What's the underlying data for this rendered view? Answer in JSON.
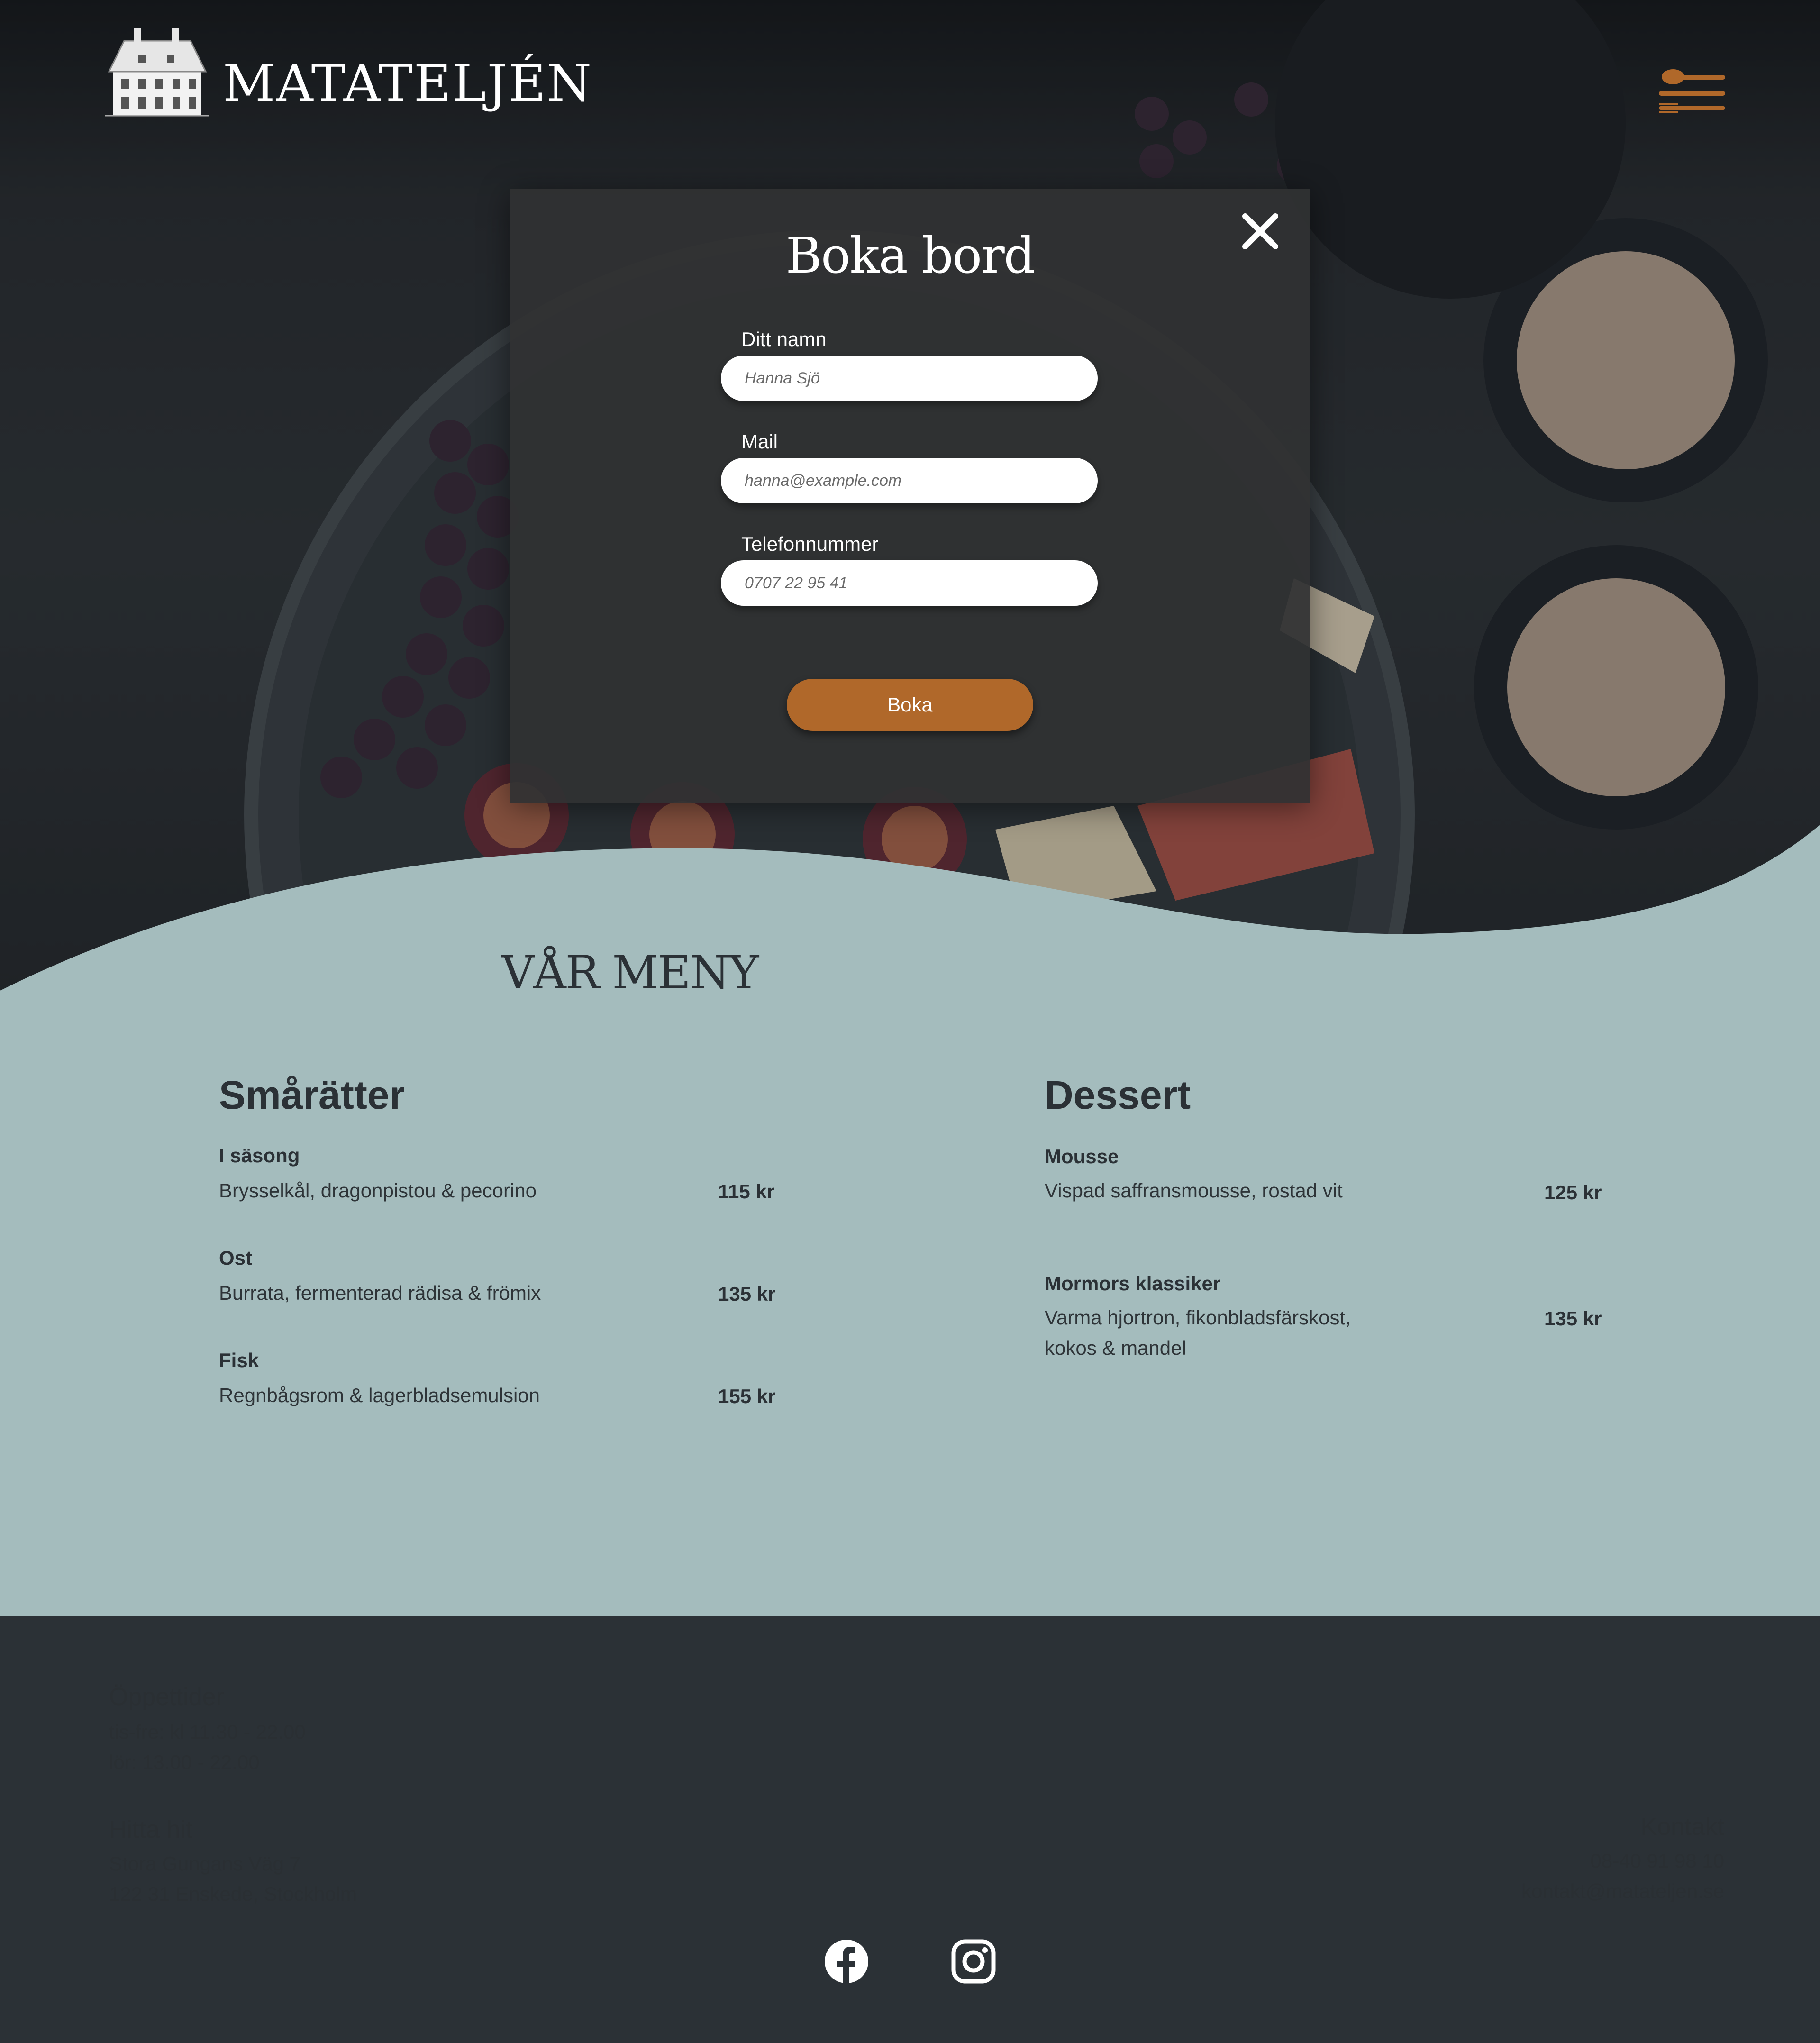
{
  "header": {
    "logo_text": "MATATELJÉN",
    "menu_icon": "cutlery-menu-icon"
  },
  "modal": {
    "title": "Boka bord",
    "close_icon": "close-icon",
    "fields": [
      {
        "label": "Ditt namn",
        "placeholder": "Hanna Sjö"
      },
      {
        "label": "Mail",
        "placeholder": "hanna@example.com"
      },
      {
        "label": "Telefonnummer",
        "placeholder": "0707 22 95 41"
      }
    ],
    "submit_label": "Boka"
  },
  "menu": {
    "title": "VÅR MENY",
    "columns": [
      {
        "title": "Smårätter",
        "items": [
          {
            "name": "I säsong",
            "desc": "Brysselkål, dragonpistou & pecorino",
            "price": "115 kr"
          },
          {
            "name": "Ost",
            "desc": "Burrata, fermenterad rädisa & frömix",
            "price": "135 kr"
          },
          {
            "name": "Fisk",
            "desc": "Regnbågsrom & lagerbladsemulsion",
            "price": "155 kr"
          }
        ]
      },
      {
        "title": "Dessert",
        "items": [
          {
            "name": "Mousse",
            "desc": "Vispad saffransmousse, rostad vit",
            "price": "125 kr"
          },
          {
            "name": "Mormors klassiker",
            "desc": "Varma hjortron, fikonbladsfärskost, kokos & mandel",
            "price": "135 kr"
          }
        ]
      }
    ]
  },
  "footer": {
    "hours": {
      "title": "Öppettider",
      "lines": [
        "tis-fre: kl 11.30 - 22.00",
        "lör: 13.00 - 22.00"
      ]
    },
    "address": {
      "title": "Hitta hit",
      "lines": [
        "Stora Gungans Väg 7",
        "122 31 Enskede, Stockholm"
      ]
    },
    "contact": {
      "title": "Kontakt",
      "lines": [
        "08-40 91 98 10",
        "kontakt@matateljen.se"
      ]
    },
    "social": [
      "facebook-icon",
      "instagram-icon"
    ]
  },
  "colors": {
    "accent": "#b0682a",
    "menu_bg": "#a4bcbd",
    "footer_bg": "#2b3136",
    "modal_bg": "#303233"
  }
}
